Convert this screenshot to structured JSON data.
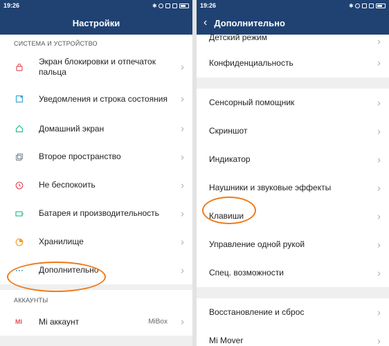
{
  "left": {
    "status": {
      "time": "19:26"
    },
    "title": "Настройки",
    "section1": "СИСТЕМА И УСТРОЙСТВО",
    "items": [
      {
        "label": "Экран блокировки и отпечаток пальца",
        "icon": "lock-icon",
        "color": "#e8505b"
      },
      {
        "label": "Уведомления и строка состояния",
        "icon": "notification-icon",
        "color": "#3aa8d8"
      },
      {
        "label": "Домашний экран",
        "icon": "home-icon",
        "color": "#2bbf8f"
      },
      {
        "label": "Второе пространство",
        "icon": "second-space-icon",
        "color": "#8b95a5"
      },
      {
        "label": "Не беспокоить",
        "icon": "do-not-disturb-icon",
        "color": "#e8505b"
      },
      {
        "label": "Батарея и производительность",
        "icon": "battery-icon",
        "color": "#2bbf8f"
      },
      {
        "label": "Хранилище",
        "icon": "storage-icon",
        "color": "#f0a030"
      },
      {
        "label": "Дополнительно",
        "icon": "more-icon",
        "color": "#3aa8d8"
      }
    ],
    "section2": "АККАУНТЫ",
    "account": {
      "label": "Mi аккаунт",
      "value": "MiBox",
      "icon": "mi-icon",
      "color": "#e8505b"
    }
  },
  "right": {
    "status": {
      "time": "19:26"
    },
    "title": "Дополнительно",
    "items_top": [
      {
        "label": "Детский режим"
      },
      {
        "label": "Конфиденциальность"
      }
    ],
    "items_mid": [
      {
        "label": "Сенсорный помощник"
      },
      {
        "label": "Скриншот"
      },
      {
        "label": "Индикатор"
      },
      {
        "label": "Наушники и звуковые эффекты"
      },
      {
        "label": "Клавиши"
      },
      {
        "label": "Управление одной рукой"
      },
      {
        "label": "Спец. возможности"
      }
    ],
    "items_bottom": [
      {
        "label": "Восстановление и сброс"
      },
      {
        "label": "Mi Mover"
      }
    ]
  },
  "colors": {
    "header": "#1f4272",
    "highlight": "#f07a16"
  }
}
